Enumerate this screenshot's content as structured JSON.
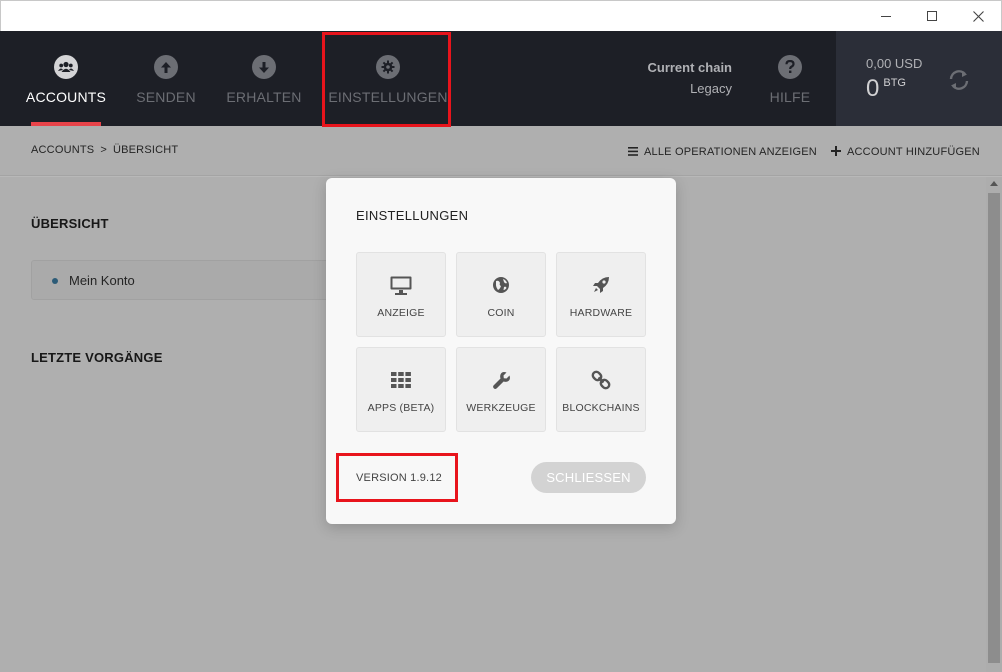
{
  "window": {
    "controls": [
      "minimize",
      "maximize",
      "close"
    ]
  },
  "nav": {
    "items": [
      {
        "label": "ACCOUNTS",
        "icon": "users-icon",
        "active": true
      },
      {
        "label": "SENDEN",
        "icon": "arrow-up-icon",
        "active": false
      },
      {
        "label": "ERHALTEN",
        "icon": "arrow-down-icon",
        "active": false
      },
      {
        "label": "EINSTELLUNGEN",
        "icon": "gear-icon",
        "active": false
      }
    ],
    "chain_label": "Current chain",
    "chain_value": "Legacy",
    "help_label": "HILFE",
    "help_icon": "question-icon"
  },
  "balance": {
    "fiat": "0,00 USD",
    "amount": "0",
    "currency": "BTG",
    "refresh_icon": "refresh-icon"
  },
  "toolbar": {
    "breadcrumb": [
      "ACCOUNTS",
      ">",
      "ÜBERSICHT"
    ],
    "all_ops_label": "ALLE OPERATIONEN ANZEIGEN",
    "add_account_label": "ACCOUNT HINZUFÜGEN"
  },
  "main": {
    "overview_title": "ÜBERSICHT",
    "account_name": "Mein Konto",
    "recent_title": "LETZTE VORGÄNGE"
  },
  "modal": {
    "title": "EINSTELLUNGEN",
    "tiles": [
      {
        "label": "ANZEIGE",
        "icon": "monitor-icon"
      },
      {
        "label": "COIN",
        "icon": "globe-icon"
      },
      {
        "label": "HARDWARE",
        "icon": "rocket-icon"
      },
      {
        "label": "APPS (BETA)",
        "icon": "grid-icon"
      },
      {
        "label": "WERKZEUGE",
        "icon": "wrench-icon"
      },
      {
        "label": "BLOCKCHAINS",
        "icon": "link-icon"
      }
    ],
    "version": "VERSION 1.9.12",
    "close_label": "SCHLIESSEN"
  },
  "colors": {
    "header_bg": "#1d1f26",
    "accent": "#e9444a",
    "highlight": "#e8141c"
  }
}
